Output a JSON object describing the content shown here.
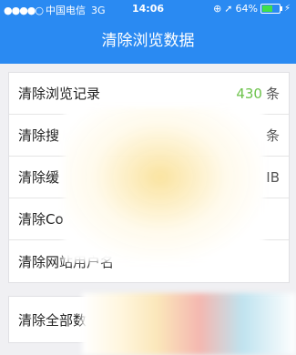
{
  "status_bar": {
    "carrier": "中国电信",
    "network": "3G",
    "time": "14:06",
    "battery": "64%",
    "battery_level": 0.64
  },
  "nav": {
    "title": "清除浏览数据"
  },
  "rows": [
    {
      "label": "清除浏览记录",
      "count": "430",
      "unit": "条"
    },
    {
      "label": "清除搜",
      "unit": "条"
    },
    {
      "label": "清除缓",
      "unit": "IB"
    },
    {
      "label": "清除Co"
    },
    {
      "label": "清除网站用户名"
    }
  ],
  "clear_all": {
    "label": "清除全部数"
  },
  "colors": {
    "accent": "#2a8af2",
    "count_green": "#6cc24a"
  }
}
